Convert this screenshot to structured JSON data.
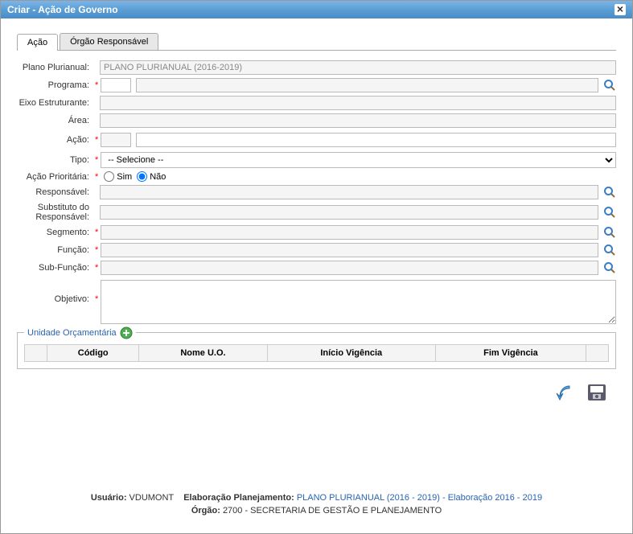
{
  "window": {
    "title": "Criar - Ação de Governo"
  },
  "tabs": {
    "acao": "Ação",
    "orgao": "Órgão Responsável"
  },
  "labels": {
    "plano": "Plano Plurianual:",
    "programa": "Programa:",
    "eixo": "Eixo Estruturante:",
    "area": "Área:",
    "acao": "Ação:",
    "tipo": "Tipo:",
    "prio": "Ação Prioritária:",
    "resp": "Responsável:",
    "sub_resp": "Substituto do Responsável:",
    "segmento": "Segmento:",
    "funcao": "Função:",
    "subfuncao": "Sub-Função:",
    "objetivo": "Objetivo:"
  },
  "values": {
    "plano": "PLANO PLURIANUAL (2016-2019)",
    "tipo_selected": "-- Selecione --"
  },
  "radio": {
    "sim": "Sim",
    "nao": "Não"
  },
  "fieldset": {
    "legend": "Unidade Orçamentária"
  },
  "table_headers": {
    "codigo": "Código",
    "nome": "Nome U.O.",
    "inicio": "Início Vigência",
    "fim": "Fim Vigência"
  },
  "footer": {
    "usuario_label": "Usuário:",
    "usuario": "VDUMONT",
    "elab_label": "Elaboração Planejamento:",
    "elab_link": "PLANO PLURIANUAL (2016 - 2019) - Elaboração 2016 - 2019",
    "orgao_label": "Órgão:",
    "orgao": "2700 - SECRETARIA DE GESTÃO E PLANEJAMENTO"
  }
}
